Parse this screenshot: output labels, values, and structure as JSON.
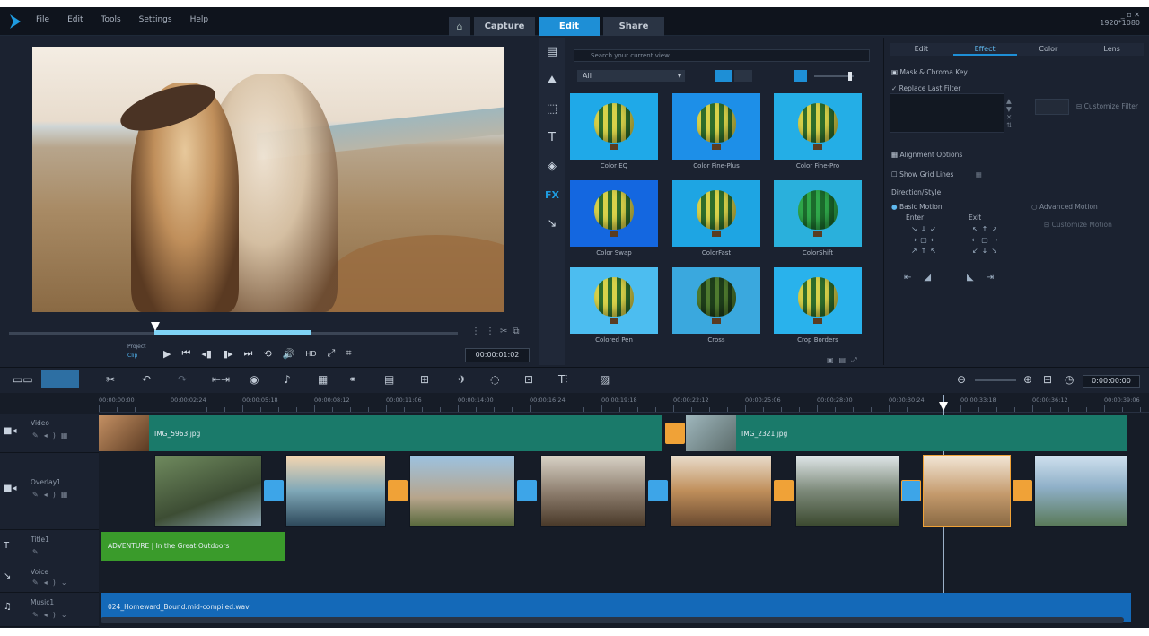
{
  "menu": [
    "File",
    "Edit",
    "Tools",
    "Settings",
    "Help"
  ],
  "nav": {
    "home_icon": "home-icon",
    "tabs": [
      "Capture",
      "Edit",
      "Share"
    ],
    "active": "Edit"
  },
  "window": {
    "controls": "_ ▫ ✕",
    "resolution": "1920*1080"
  },
  "player": {
    "mode_label": "Project",
    "mode_sub": "Clip",
    "timecode": "00:00:01:02",
    "transport": [
      "play-icon",
      "home-icon",
      "prev-frame-icon",
      "next-frame-icon",
      "end-icon",
      "repeat-icon",
      "volume-icon",
      "hd-icon",
      "enlarge-icon",
      "snapshot-icon"
    ],
    "transport_glyphs": [
      "▶",
      "⏮",
      "◂▮",
      "▮▸",
      "⏭",
      "⟲",
      "🔊",
      "HD",
      "⤢",
      "⌗"
    ]
  },
  "library": {
    "search_placeholder": "Search your current view",
    "filter_value": "All",
    "side_icons": [
      "Media",
      "Instant Project",
      "Transition",
      "T",
      "Graphics",
      "FX",
      "Path"
    ],
    "side_glyphs": [
      "▤",
      "⛰",
      "⬚",
      "T",
      "◈",
      "FX",
      "↘"
    ],
    "items": [
      {
        "label": "Color EQ",
        "bg": "#1fa9e8"
      },
      {
        "label": "Color Fine-Plus",
        "bg": "#1d8fe8"
      },
      {
        "label": "Color Fine-Pro",
        "bg": "#24aee6"
      },
      {
        "label": "Color Swap",
        "bg": "#1467e0"
      },
      {
        "label": "ColorFast",
        "bg": "#1ea5e3"
      },
      {
        "label": "ColorShift",
        "bg": "#2ab0dc"
      },
      {
        "label": "Colored Pen",
        "bg": "#4cbdf0"
      },
      {
        "label": "Cross",
        "bg": "#3aa8de"
      },
      {
        "label": "Crop Borders",
        "bg": "#29b2ec"
      }
    ]
  },
  "options": {
    "tabs": [
      "Edit",
      "Effect",
      "Color",
      "Lens"
    ],
    "active_tab": "Effect",
    "mask_label": "Mask & Chroma Key",
    "replace_label": "Replace Last Filter",
    "customize_label": "Customize Filter",
    "alignment_label": "Alignment Options",
    "grid_label": "Show Grid Lines",
    "direction_label": "Direction/Style",
    "basic_label": "Basic Motion",
    "advanced_label": "Advanced Motion",
    "customize_motion": "Customize Motion",
    "enter_label": "Enter",
    "exit_label": "Exit"
  },
  "timeline": {
    "timecode": "0:00:00:00",
    "ruler": [
      "00:00:00:00",
      "00:00:02:24",
      "00:00:05:18",
      "00:00:08:12",
      "00:00:11:06",
      "00:00:14:00",
      "00:00:16:24",
      "00:00:19:18",
      "00:00:22:12",
      "00:00:25:06",
      "00:00:28:00",
      "00:00:30:24",
      "00:00:33:18",
      "00:00:36:12",
      "00:00:39:06"
    ],
    "tracks": [
      {
        "name": "Video",
        "icon": "video-track-icon",
        "glyph": "■◂"
      },
      {
        "name": "Overlay1",
        "icon": "overlay-track-icon",
        "glyph": "■◂"
      },
      {
        "name": "Title1",
        "icon": "title-track-icon",
        "glyph": "T"
      },
      {
        "name": "Voice",
        "icon": "voice-track-icon",
        "glyph": "↘"
      },
      {
        "name": "Music1",
        "icon": "music-track-icon",
        "glyph": "♫"
      }
    ],
    "video_clips": [
      {
        "name": "IMG_5963.jpg"
      },
      {
        "name": "IMG_2321.jpg"
      }
    ],
    "title_clip": "ADVENTURE | In the Great Outdoors",
    "music_clip": "024_Homeward_Bound.mid-compiled.wav",
    "colors": {
      "video": "#1a7a6a",
      "title": "#3a9b2b",
      "music": "#1469b8",
      "transition": "#f0a237"
    }
  }
}
